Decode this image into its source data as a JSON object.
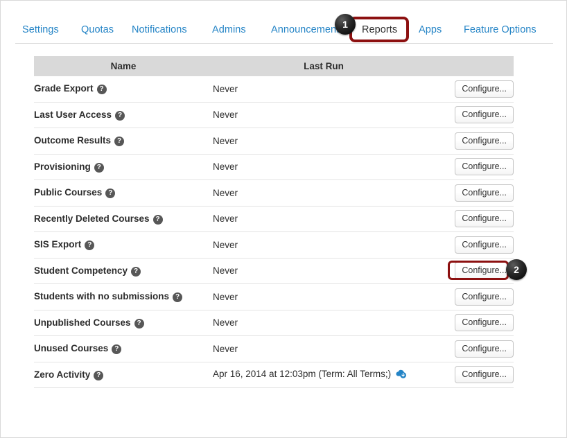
{
  "tabs": [
    {
      "id": "settings",
      "label": "Settings",
      "active": false
    },
    {
      "id": "quotas",
      "label": "Quotas",
      "active": false
    },
    {
      "id": "notifications",
      "label": "Notifications",
      "active": false
    },
    {
      "id": "admins",
      "label": "Admins",
      "active": false
    },
    {
      "id": "announcements",
      "label": "Announcements",
      "active": false
    },
    {
      "id": "reports",
      "label": "Reports",
      "active": true
    },
    {
      "id": "apps",
      "label": "Apps",
      "active": false
    },
    {
      "id": "featureoptions",
      "label": "Feature Options",
      "active": false
    }
  ],
  "annotations": {
    "badge_one": "1",
    "badge_two": "2",
    "highlight_color": "#8c1010",
    "badge_color": "#000000"
  },
  "table": {
    "headers": {
      "name": "Name",
      "last_run": "Last Run",
      "action": ""
    },
    "help_glyph": "?",
    "rows": [
      {
        "name": "Grade Export",
        "last_run": "Never",
        "action": "Configure...",
        "has_download": false,
        "highlighted": false
      },
      {
        "name": "Last User Access",
        "last_run": "Never",
        "action": "Configure...",
        "has_download": false,
        "highlighted": false
      },
      {
        "name": "Outcome Results",
        "last_run": "Never",
        "action": "Configure...",
        "has_download": false,
        "highlighted": false
      },
      {
        "name": "Provisioning",
        "last_run": "Never",
        "action": "Configure...",
        "has_download": false,
        "highlighted": false
      },
      {
        "name": "Public Courses",
        "last_run": "Never",
        "action": "Configure...",
        "has_download": false,
        "highlighted": false
      },
      {
        "name": "Recently Deleted Courses",
        "last_run": "Never",
        "action": "Configure...",
        "has_download": false,
        "highlighted": false
      },
      {
        "name": "SIS Export",
        "last_run": "Never",
        "action": "Configure...",
        "has_download": false,
        "highlighted": false
      },
      {
        "name": "Student Competency",
        "last_run": "Never",
        "action": "Configure...",
        "has_download": false,
        "highlighted": true
      },
      {
        "name": "Students with no submissions",
        "last_run": "Never",
        "action": "Configure...",
        "has_download": false,
        "highlighted": false
      },
      {
        "name": "Unpublished Courses",
        "last_run": "Never",
        "action": "Configure...",
        "has_download": false,
        "highlighted": false
      },
      {
        "name": "Unused Courses",
        "last_run": "Never",
        "action": "Configure...",
        "has_download": false,
        "highlighted": false
      },
      {
        "name": "Zero Activity",
        "last_run": "Apr 16, 2014 at 12:03pm (Term: All Terms;)",
        "action": "Configure...",
        "has_download": true,
        "highlighted": false
      }
    ]
  },
  "colors": {
    "tab_link": "#2484c6",
    "header_bg": "#d9d9d9",
    "text": "#2d2d2d",
    "download_icon": "#2484c6"
  }
}
